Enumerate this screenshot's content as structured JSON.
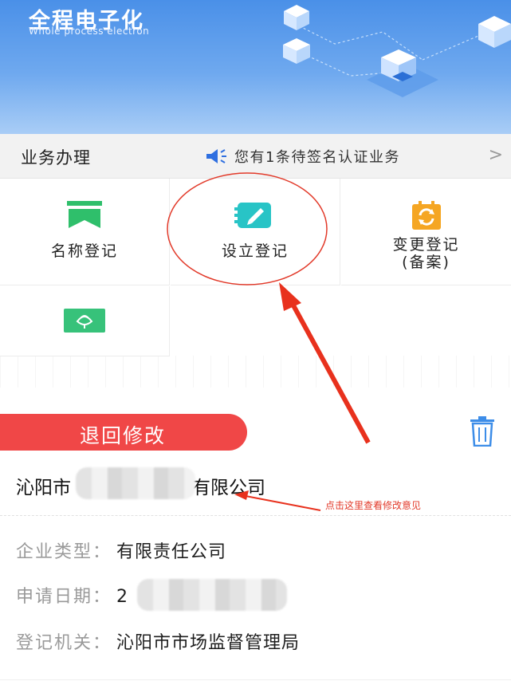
{
  "banner": {
    "title": "全程电子化",
    "subtitle": "Whole process electron"
  },
  "business_bar": {
    "title": "业务办理",
    "notice_icon": "megaphone-icon",
    "notice": "您有1条待签名认证业务",
    "chevron": ">"
  },
  "services": [
    {
      "label": "名称登记",
      "icon": "bookmark-icon",
      "color": "#2fbf6b"
    },
    {
      "label": "设立登记",
      "icon": "edit-icon",
      "color": "#28c4c6"
    },
    {
      "label": "变更登记\n(备案)",
      "icon": "refresh-icon",
      "color": "#f5a623"
    },
    {
      "label": "",
      "icon": "lotus-icon",
      "color": "#37c27a"
    }
  ],
  "card": {
    "status": "退回修改",
    "status_color": "#f04747",
    "trash_icon": "trash-icon",
    "company_prefix": "沁阳市",
    "company_suffix": "有限公司",
    "annotation": "点击这里查看修改意见",
    "fields": [
      {
        "key": "企业类型：",
        "value": "有限责任公司"
      },
      {
        "key": "申请日期：",
        "value": "2"
      },
      {
        "key": "登记机关：",
        "value": "沁阳市市场监督管理局"
      }
    ],
    "date_tail": "]"
  }
}
